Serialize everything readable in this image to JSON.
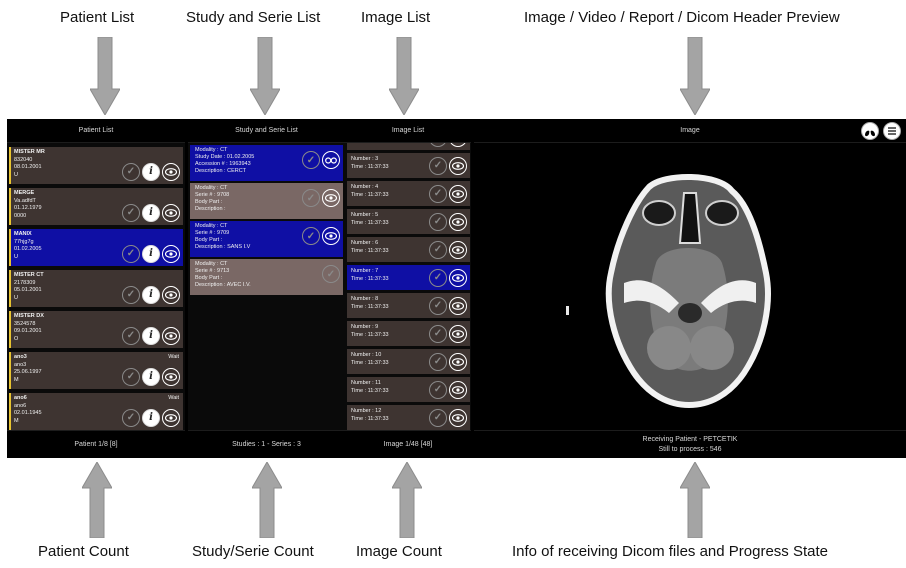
{
  "annotations": {
    "top": [
      "Patient List",
      "Study and Serie List",
      "Image List",
      "Image / Video / Report / Dicom Header Preview"
    ],
    "bottom": [
      "Patient Count",
      "Study/Serie Count",
      "Image Count",
      "Info of receiving Dicom files and Progress State"
    ]
  },
  "patient_panel": {
    "header": "Patient List",
    "footer": "Patient 1/8 [8]",
    "patients": [
      {
        "name": "MISTER MR",
        "id": "832040",
        "date": "08.01.2001",
        "sex": "U",
        "status": ""
      },
      {
        "name": "MERGE",
        "id": "Va.adfdT",
        "date": "01.12.1979",
        "sex": "0000",
        "status": ""
      },
      {
        "name": "MANIX",
        "id": "77hjg7g",
        "date": "01.02.2005",
        "sex": "U",
        "status": ""
      },
      {
        "name": "MISTER CT",
        "id": "2178309",
        "date": "05.01.2001",
        "sex": "U",
        "status": ""
      },
      {
        "name": "MISTER DX",
        "id": "3524578",
        "date": "09.01.2001",
        "sex": "O",
        "status": ""
      },
      {
        "name": "ano3",
        "id": "ano3",
        "date": "25.06.1997",
        "sex": "M",
        "status": "Wait"
      },
      {
        "name": "ano6",
        "id": "ano6",
        "date": "02.01.1945",
        "sex": "M",
        "status": "Wait"
      }
    ]
  },
  "study_panel": {
    "header": "Study and Serie List",
    "footer": "Studies : 1 - Series : 3",
    "study": {
      "line1": "Modality : CT",
      "line2": "Study Date : 01.02.2005",
      "line3": "Accession # : 1963943",
      "line4": "Description : CERCT"
    },
    "series": [
      {
        "line1": "Modality : CT",
        "line2": "Serie # : 9708",
        "line3": "Body Part :",
        "line4": "Description :"
      },
      {
        "line1": "Modality : CT",
        "line2": "Serie # : 9709",
        "line3": "Body Part :",
        "line4": "Description : SANS I.V"
      },
      {
        "line1": "Modality : CT",
        "line2": "Serie # : 9713",
        "line3": "Body Part :",
        "line4": "Description : AVEC I.V."
      }
    ]
  },
  "image_panel": {
    "header": "Image List",
    "footer": "Image 1/48 [48]",
    "images": [
      {
        "number": "Number : 3",
        "time": "Time : 11:37:33"
      },
      {
        "number": "Number : 4",
        "time": "Time : 11:37:33"
      },
      {
        "number": "Number : 5",
        "time": "Time : 11:37:33"
      },
      {
        "number": "Number : 6",
        "time": "Time : 11:37:33"
      },
      {
        "number": "Number : 7",
        "time": "Time : 11:37:33"
      },
      {
        "number": "Number : 8",
        "time": "Time : 11:37:33"
      },
      {
        "number": "Number : 9",
        "time": "Time : 11:37:33"
      },
      {
        "number": "Number : 10",
        "time": "Time : 11:37:33"
      },
      {
        "number": "Number : 11",
        "time": "Time : 11:37:33"
      },
      {
        "number": "Number : 12",
        "time": "Time : 11:37:33"
      }
    ]
  },
  "preview_panel": {
    "header": "Image",
    "status_line1": "Receiving Patient - PETCETIK",
    "status_line2": "Still to process : 546"
  },
  "icons": {
    "check": "checkmark-icon",
    "info": "info-icon",
    "eye": "eye-icon",
    "binoculars": "binoculars-icon",
    "lungs": "lungs-icon",
    "report": "report-icon"
  }
}
